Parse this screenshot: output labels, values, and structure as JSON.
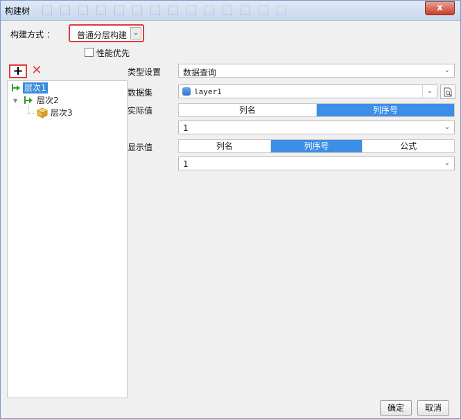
{
  "window": {
    "title": "构建树",
    "close_label": "x"
  },
  "build_mode": {
    "label": "构建方式 ：",
    "value": "普通分层构建"
  },
  "performance": {
    "label": "性能优先",
    "checked": false
  },
  "toolbar": {
    "add_label": "+",
    "delete_label": "✕"
  },
  "tree": {
    "nodes": [
      {
        "label": "层次1",
        "selected": true
      },
      {
        "label": "层次2",
        "selected": false
      },
      {
        "label": "层次3",
        "selected": false
      }
    ]
  },
  "form": {
    "type_label": "类型设置",
    "type_value": "数据查询",
    "dataset_label": "数据集",
    "dataset_value": "layer1",
    "actual_label": "实际值",
    "actual_options": [
      "列名",
      "列序号"
    ],
    "actual_active": "列序号",
    "actual_value": "1",
    "display_label": "显示值",
    "display_options": [
      "列名",
      "列序号",
      "公式"
    ],
    "display_active": "列序号",
    "display_value": "1"
  },
  "buttons": {
    "ok": "确定",
    "cancel": "取消"
  },
  "colors": {
    "accent": "#3d8ee6",
    "highlight_border": "#e03a3a",
    "selected_node": "#3b8bd9"
  }
}
